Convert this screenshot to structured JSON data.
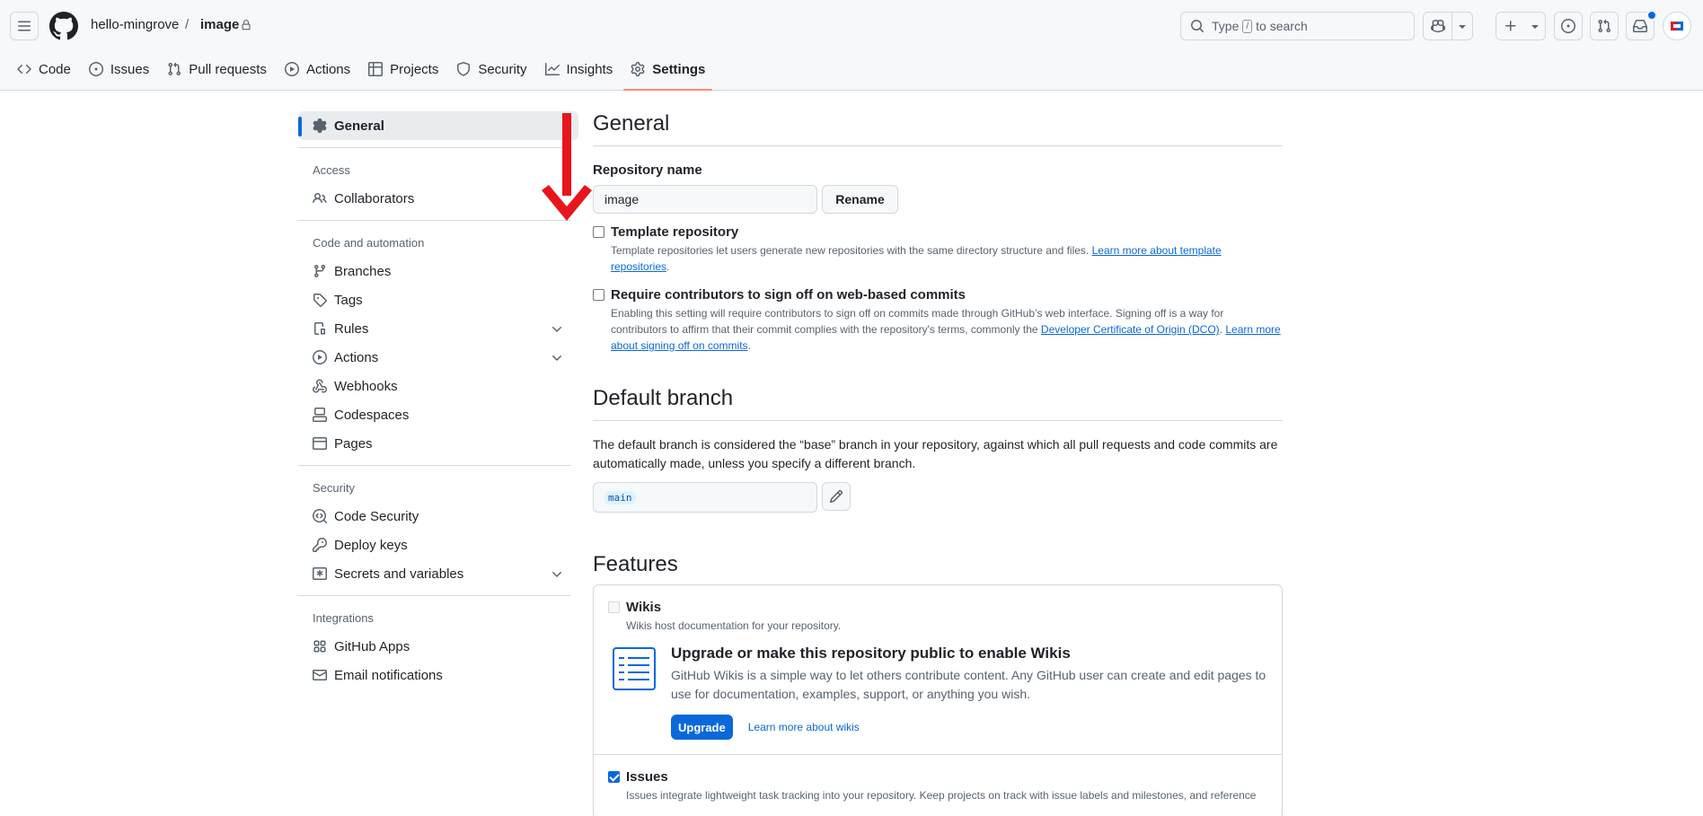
{
  "header": {
    "owner": "hello-mingrove",
    "separator": "/",
    "repo": "image",
    "search": {
      "prefix": "Type",
      "key": "/",
      "suffix": "to search"
    }
  },
  "tabs": [
    {
      "label": "Code",
      "icon": "code-icon"
    },
    {
      "label": "Issues",
      "icon": "issue-icon"
    },
    {
      "label": "Pull requests",
      "icon": "pull-request-icon"
    },
    {
      "label": "Actions",
      "icon": "play-icon"
    },
    {
      "label": "Projects",
      "icon": "table-icon"
    },
    {
      "label": "Security",
      "icon": "shield-icon"
    },
    {
      "label": "Insights",
      "icon": "graph-icon"
    },
    {
      "label": "Settings",
      "icon": "gear-icon",
      "active": true
    }
  ],
  "sidebar": {
    "general": "General",
    "access_head": "Access",
    "collaborators": "Collaborators",
    "code_head": "Code and automation",
    "branches": "Branches",
    "tags": "Tags",
    "rules": "Rules",
    "actions": "Actions",
    "webhooks": "Webhooks",
    "codespaces": "Codespaces",
    "pages": "Pages",
    "security_head": "Security",
    "code_security": "Code Security",
    "deploy_keys": "Deploy keys",
    "secrets": "Secrets and variables",
    "integrations_head": "Integrations",
    "github_apps": "GitHub Apps",
    "email_notifications": "Email notifications"
  },
  "general": {
    "title": "General",
    "repo_name_label": "Repository name",
    "repo_name_value": "image",
    "rename_button": "Rename",
    "template": {
      "title": "Template repository",
      "desc": "Template repositories let users generate new repositories with the same directory structure and files.",
      "link": "Learn more about template repositories",
      "end": "."
    },
    "signoff": {
      "title": "Require contributors to sign off on web-based commits",
      "desc": "Enabling this setting will require contributors to sign off on commits made through GitHub’s web interface. Signing off is a way for contributors to affirm that their commit complies with the repository's terms, commonly the",
      "link1": "Developer Certificate of Origin (DCO)",
      "mid": ".",
      "link2": "Learn more about signing off on commits",
      "end": "."
    }
  },
  "default_branch": {
    "title": "Default branch",
    "desc": "The default branch is considered the “base” branch in your repository, against which all pull requests and code commits are automatically made, unless you specify a different branch.",
    "branch": "main"
  },
  "features": {
    "title": "Features",
    "wikis": {
      "title": "Wikis",
      "desc": "Wikis host documentation for your repository.",
      "upgrade_title": "Upgrade or make this repository public to enable Wikis",
      "upgrade_desc": "GitHub Wikis is a simple way to let others contribute content. Any GitHub user can create and edit pages to use for documentation, examples, support, or anything you wish.",
      "upgrade_button": "Upgrade",
      "learn_link": "Learn more about wikis"
    },
    "issues": {
      "title": "Issues",
      "desc": "Issues integrate lightweight task tracking into your repository. Keep projects on track with issue labels and milestones, and reference"
    }
  },
  "colors": {
    "accent": "#0969da",
    "tab_underline": "#fd8c73",
    "annotation_arrow": "#e8161c"
  }
}
